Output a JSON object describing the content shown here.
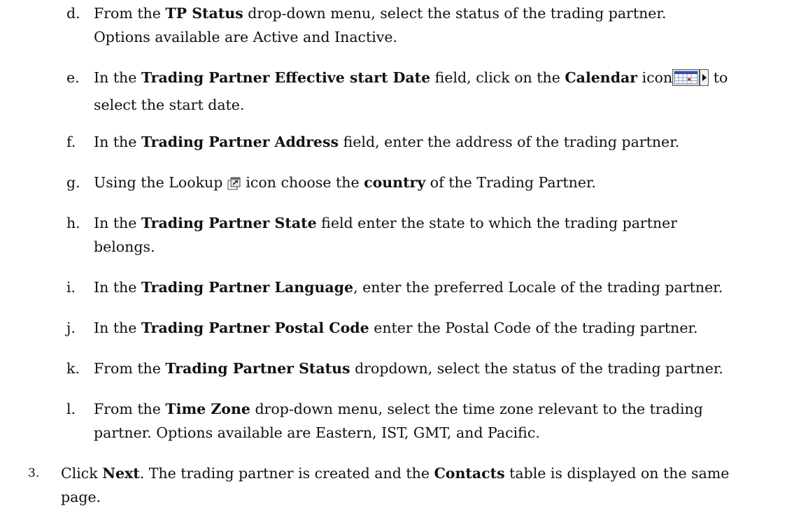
{
  "items": [
    {
      "letter": "d.",
      "parts": [
        [
          "From the ",
          false
        ],
        [
          "TP Status",
          true
        ],
        [
          " drop-down menu, select the status of the trading partner.",
          false
        ]
      ],
      "line2": "Options available are Active and Inactive."
    },
    {
      "letter": "e.",
      "parts": [
        [
          "In the ",
          false
        ],
        [
          "Trading Partner Effective start Date",
          true
        ],
        [
          " field, click on the ",
          false
        ],
        [
          "Calendar",
          true
        ],
        [
          " icon",
          false
        ]
      ],
      "after_icon": " to",
      "line2": "select the start date.",
      "icon": "calendar-icon"
    },
    {
      "letter": "f.",
      "parts": [
        [
          "In the ",
          false
        ],
        [
          "Trading Partner Address",
          true
        ],
        [
          " field, enter the address of the trading partner.",
          false
        ]
      ]
    },
    {
      "letter": "g.",
      "parts": [
        [
          "Using the Lookup ",
          false
        ]
      ],
      "icon": "lookup-icon",
      "after_icon_parts": [
        [
          " icon choose the ",
          false
        ],
        [
          "country",
          true
        ],
        [
          " of the Trading Partner.",
          false
        ]
      ]
    },
    {
      "letter": "h.",
      "parts": [
        [
          "In the ",
          false
        ],
        [
          "Trading Partner State",
          true
        ],
        [
          " field enter the state to which the trading partner",
          false
        ]
      ],
      "line2": "belongs."
    },
    {
      "letter": "i.",
      "parts": [
        [
          "In the ",
          false
        ],
        [
          "Trading Partner Language",
          true
        ],
        [
          ", enter the preferred Locale of the trading partner.",
          false
        ]
      ]
    },
    {
      "letter": "j.",
      "parts": [
        [
          "In the ",
          false
        ],
        [
          "Trading Partner Postal Code",
          true
        ],
        [
          " enter the Postal Code of the trading partner.",
          false
        ]
      ]
    },
    {
      "letter": "k.",
      "parts": [
        [
          "From the ",
          false
        ],
        [
          "Trading Partner Status",
          true
        ],
        [
          " dropdown, select the status of the trading partner.",
          false
        ]
      ]
    },
    {
      "letter": "l.",
      "parts": [
        [
          "From the ",
          false
        ],
        [
          "Time Zone",
          true
        ],
        [
          " drop-down menu, select the time zone relevant to the trading",
          false
        ]
      ],
      "line2": "partner. Options available are Eastern, IST, GMT, and Pacific."
    }
  ],
  "step3": {
    "number": "3.",
    "parts": [
      [
        "Click ",
        false
      ],
      [
        "Next",
        true
      ],
      [
        ". The trading partner is created and the ",
        false
      ],
      [
        "Contacts",
        true
      ],
      [
        " table is displayed on the same",
        false
      ]
    ],
    "line2": "page."
  }
}
